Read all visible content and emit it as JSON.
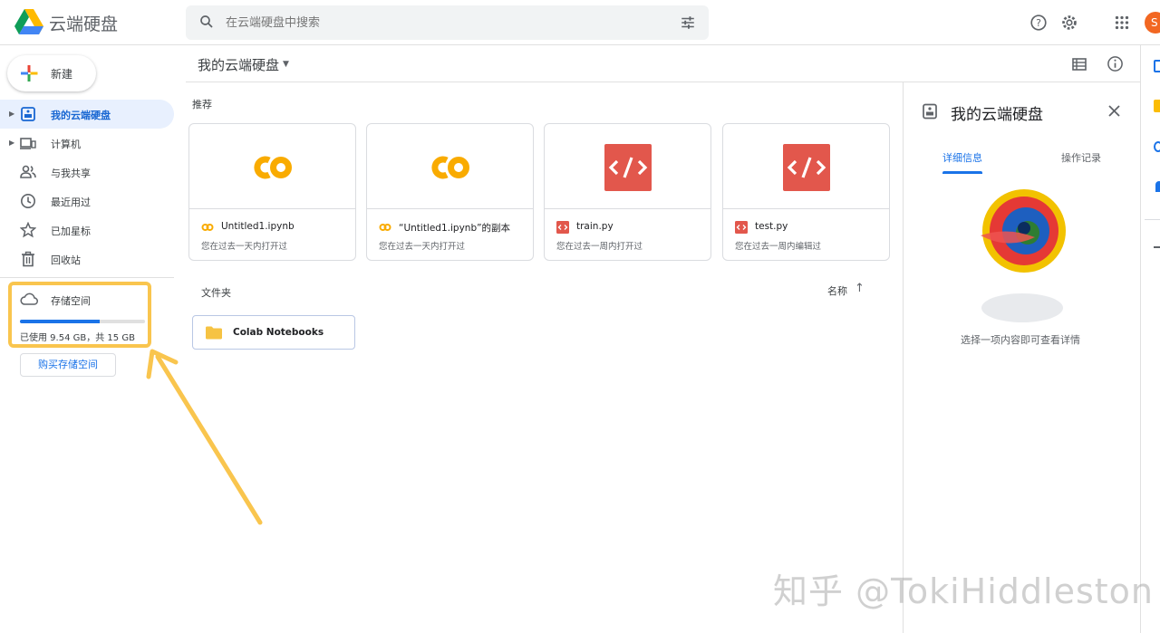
{
  "app": {
    "title": "云端硬盘"
  },
  "search": {
    "placeholder": "在云端硬盘中搜索"
  },
  "account": {
    "initial": "S"
  },
  "sidebar": {
    "new_label": "新建",
    "items": [
      {
        "label": "我的云端硬盘",
        "icon": "drive-icon",
        "active": true
      },
      {
        "label": "计算机",
        "icon": "computer-icon"
      },
      {
        "label": "与我共享",
        "icon": "people-icon"
      },
      {
        "label": "最近用过",
        "icon": "clock-icon"
      },
      {
        "label": "已加星标",
        "icon": "star-icon"
      },
      {
        "label": "回收站",
        "icon": "trash-icon"
      }
    ],
    "storage": {
      "label": "存储空间",
      "used_text": "已使用 9.54 GB，共 15 GB",
      "used_fraction": 0.636,
      "buy_label": "购买存储空间"
    }
  },
  "main": {
    "breadcrumb": "我的云端硬盘",
    "suggested_title": "推荐",
    "cards": [
      {
        "name": "Untitled1.ipynb",
        "sub": "您在过去一天内打开过",
        "type": "colab-icon"
      },
      {
        "name": "“Untitled1.ipynb”的副本",
        "sub": "您在过去一天内打开过",
        "type": "colab-icon"
      },
      {
        "name": "train.py",
        "sub": "您在过去一周内打开过",
        "type": "code-icon"
      },
      {
        "name": "test.py",
        "sub": "您在过去一周内编辑过",
        "type": "code-icon"
      }
    ],
    "folders_title": "文件夹",
    "sort_label": "名称",
    "folders": [
      {
        "name": "Colab Notebooks"
      }
    ]
  },
  "details": {
    "title": "我的云端硬盘",
    "tab_details": "详细信息",
    "tab_activity": "操作记录",
    "empty_text": "选择一项内容即可查看详情"
  },
  "watermark": "知乎 @TokiHiddleston",
  "colors": {
    "accent": "#1a73e8",
    "highlight": "#f9c54e",
    "code_red": "#e2574c",
    "colab_orange": "#f9ab00"
  }
}
